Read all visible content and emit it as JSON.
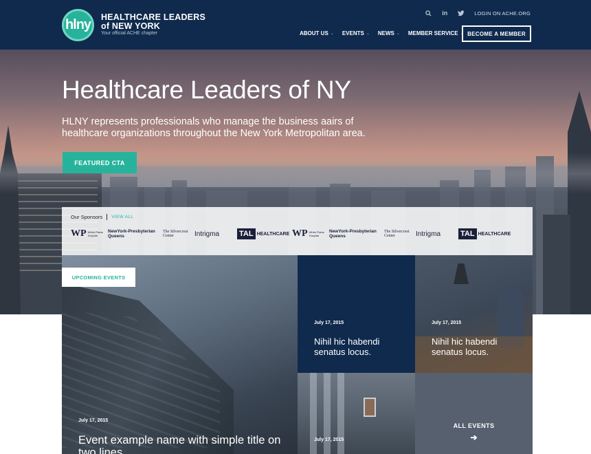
{
  "header": {
    "logo_text": "hlny",
    "brand_line1": "HEALTHCARE LEADERS",
    "brand_line2": "of NEW YORK",
    "brand_sub": "Your official ACHE chapter",
    "login_label": "LOGIN ON ACHE.ORG",
    "icons": [
      "search-icon",
      "linkedin-icon",
      "twitter-icon"
    ],
    "nav": [
      {
        "label": "ABOUT US"
      },
      {
        "label": "EVENTS"
      },
      {
        "label": "NEWS"
      },
      {
        "label": "MEMBER SERVICE"
      }
    ],
    "member_button": "BECOME A MEMBER"
  },
  "hero": {
    "title": "Healthcare Leaders of NY",
    "description": "HLNY represents professionals who manage the business aairs of healthcare organizations throughout the New York Metropolitan area.",
    "cta_label": "FEATURED CTA"
  },
  "sponsors": {
    "heading": "Our Sponsors",
    "view_all": "VIEW ALL",
    "logos": [
      {
        "mark": "WP",
        "text": "White Plains Hospital"
      },
      {
        "mark": "",
        "text": "NewYork-Presbyterian Queens"
      },
      {
        "mark": "",
        "text": "The Silvercrest Center"
      },
      {
        "mark": "",
        "text": "Intrigma"
      },
      {
        "mark": "TAL",
        "text": "HEALTHCARE"
      },
      {
        "mark": "WP",
        "text": "White Plains Hospital"
      },
      {
        "mark": "",
        "text": "NewYork-Presbyterian Queens"
      },
      {
        "mark": "",
        "text": "The Silvercrest Center"
      },
      {
        "mark": "",
        "text": "Intrigma"
      },
      {
        "mark": "TAL",
        "text": "HEALTHCARE"
      }
    ]
  },
  "events": {
    "section_label": "UPCOMING EVENTS",
    "featured": {
      "date": "July 17, 2015",
      "name": "Event example name with simple title on two lines"
    },
    "tiles": [
      {
        "date": "July 17, 2015",
        "name": "Nihil hic habendi senatus locus."
      },
      {
        "date": "July 17, 2015",
        "name": "Nihil hic habendi senatus locus."
      },
      {
        "date": "July 17, 2015",
        "name": ""
      }
    ],
    "all_events_label": "ALL EVENTS",
    "arrow": "➔"
  },
  "colors": {
    "navy": "#0f2a4d",
    "teal": "#27b39b",
    "slate": "#56606e"
  }
}
